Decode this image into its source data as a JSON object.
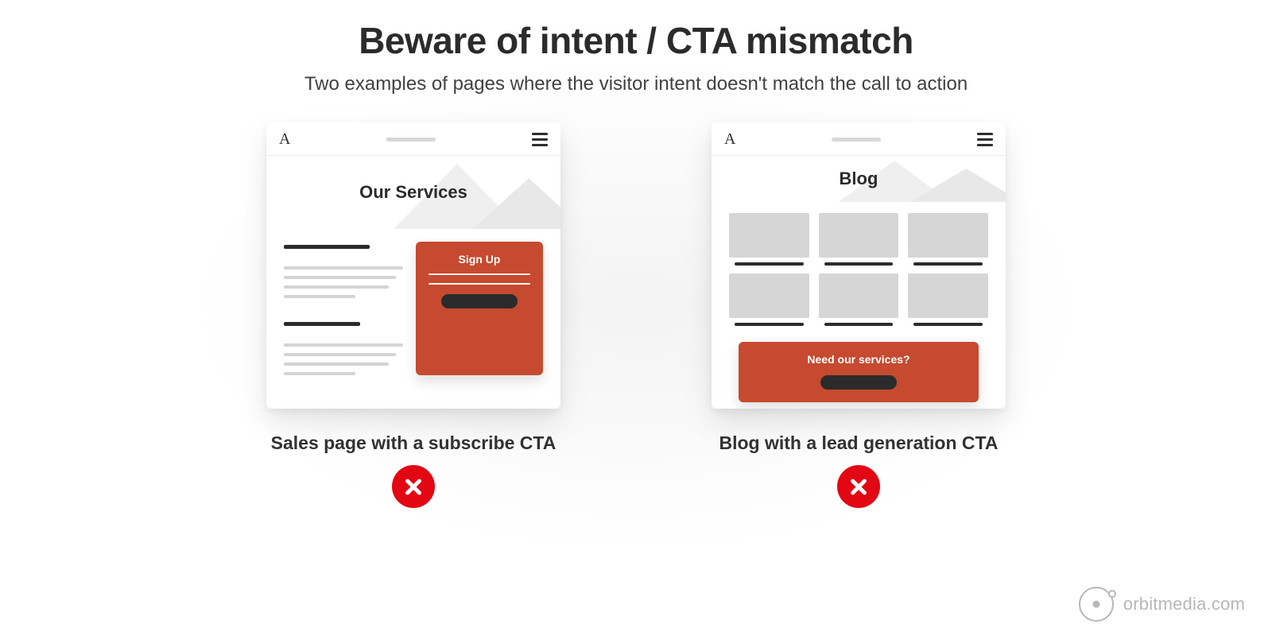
{
  "title": "Beware of intent / CTA mismatch",
  "subtitle": "Two examples of pages where the visitor intent doesn't match the call to action",
  "examples": {
    "left": {
      "logo_glyph": "A",
      "hero_title": "Our Services",
      "cta_label": "Sign Up",
      "caption": "Sales page with a subscribe CTA"
    },
    "right": {
      "logo_glyph": "A",
      "hero_title": "Blog",
      "cta_label": "Need our services?",
      "caption": "Blog with a lead generation CTA"
    }
  },
  "attribution": "orbitmedia.com",
  "colors": {
    "cta_bg": "#c64a2f",
    "error_badge": "#e30613",
    "text_dark": "#2b2b2b"
  },
  "icons": {
    "hamburger": "menu-icon",
    "badge": "x-circle-icon",
    "logo": "orbit-logo-icon"
  }
}
